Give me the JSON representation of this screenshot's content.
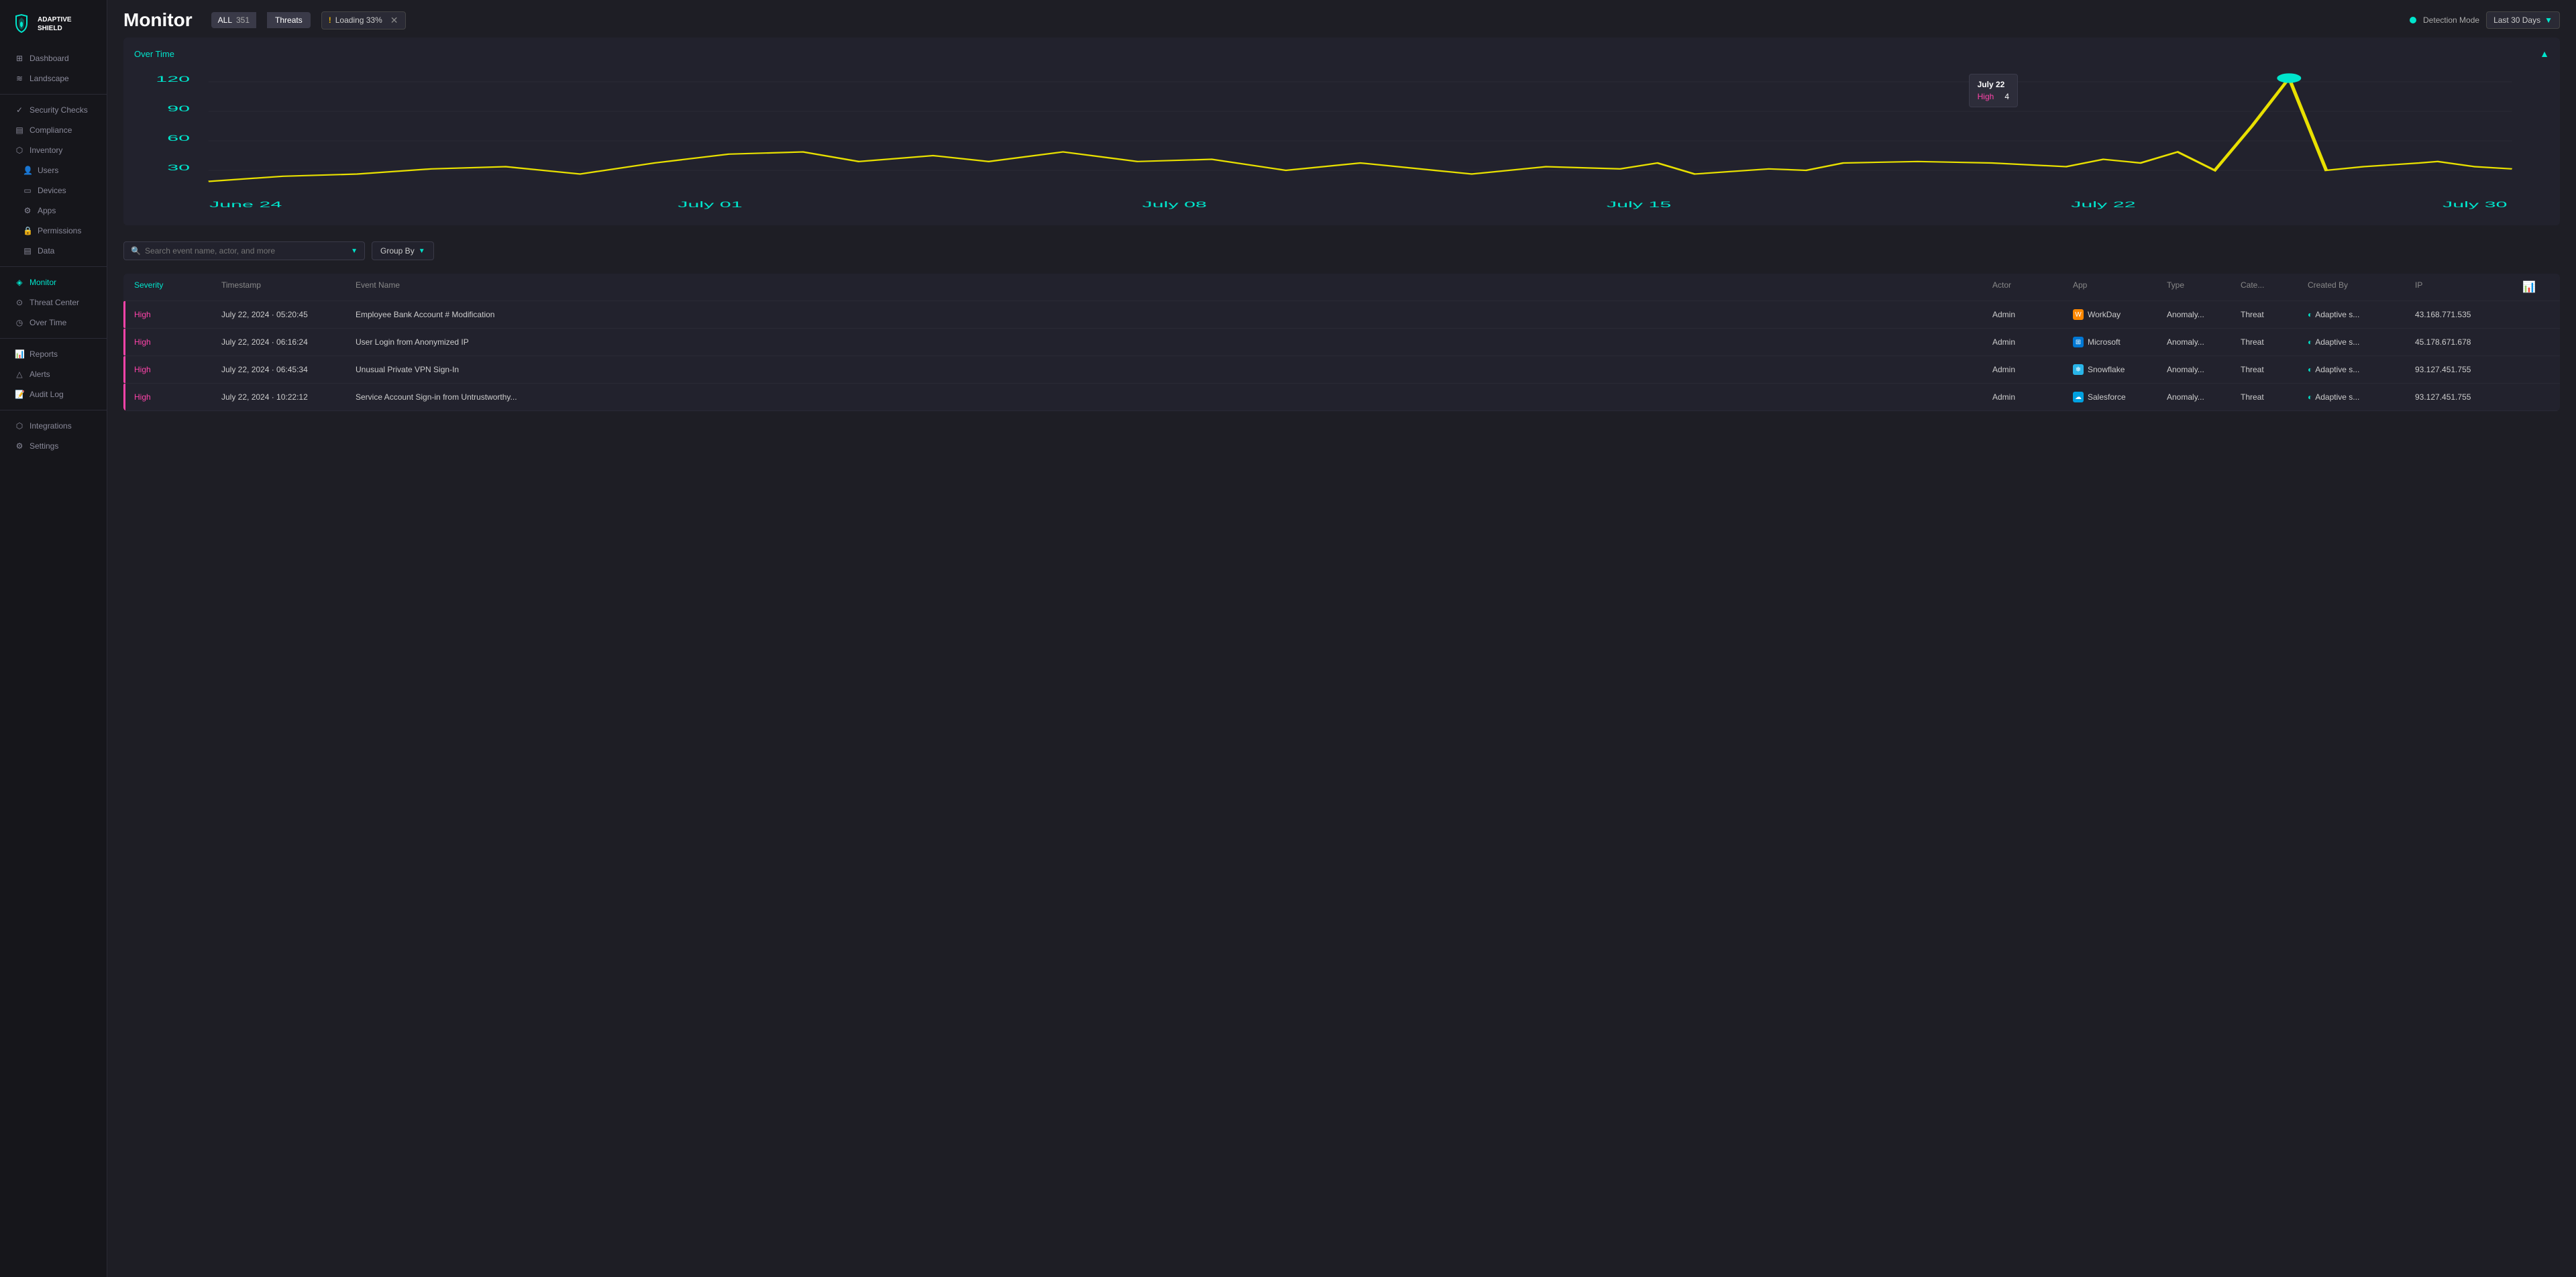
{
  "app": {
    "name": "Adaptive Shield",
    "logo_text": "ADAPTIVE\nSHIELD"
  },
  "sidebar": {
    "items": [
      {
        "id": "dashboard",
        "label": "Dashboard",
        "icon": "⊞",
        "active": false
      },
      {
        "id": "landscape",
        "label": "Landscape",
        "icon": "≋",
        "active": false
      },
      {
        "id": "security-checks",
        "label": "Security Checks",
        "icon": "✓",
        "active": false
      },
      {
        "id": "compliance",
        "label": "Compliance",
        "icon": "📋",
        "active": false
      },
      {
        "id": "inventory",
        "label": "Inventory",
        "icon": "🗂",
        "active": false
      },
      {
        "id": "users",
        "label": "Users",
        "icon": "👤",
        "active": false,
        "sub": true
      },
      {
        "id": "devices",
        "label": "Devices",
        "icon": "💻",
        "active": false,
        "sub": true
      },
      {
        "id": "apps",
        "label": "Apps",
        "icon": "⚙",
        "active": false,
        "sub": true
      },
      {
        "id": "permissions",
        "label": "Permissions",
        "icon": "🔒",
        "active": false,
        "sub": true
      },
      {
        "id": "data",
        "label": "Data",
        "icon": "🗄",
        "active": false,
        "sub": true
      },
      {
        "id": "monitor",
        "label": "Monitor",
        "icon": "◈",
        "active": true
      },
      {
        "id": "threat-center",
        "label": "Threat Center",
        "icon": "⊙",
        "active": false
      },
      {
        "id": "over-time",
        "label": "Over Time",
        "icon": "◷",
        "active": false
      },
      {
        "id": "reports",
        "label": "Reports",
        "icon": "📊",
        "active": false
      },
      {
        "id": "alerts",
        "label": "Alerts",
        "icon": "△",
        "active": false
      },
      {
        "id": "audit-log",
        "label": "Audit Log",
        "icon": "📝",
        "active": false
      },
      {
        "id": "integrations",
        "label": "Integrations",
        "icon": "⬡",
        "active": false
      },
      {
        "id": "settings",
        "label": "Settings",
        "icon": "⚙",
        "active": false
      }
    ]
  },
  "header": {
    "title": "Monitor",
    "tab_all": "ALL",
    "tab_count": "351",
    "tab_threats": "Threats",
    "loading_text": "Loading 33%",
    "detection_label": "Detection Mode",
    "days_label": "Last 30 Days"
  },
  "chart": {
    "title": "Over Time",
    "y_labels": [
      "120",
      "90",
      "60",
      "30"
    ],
    "x_labels": [
      "June 24",
      "July 01",
      "July 08",
      "July 15",
      "July 22",
      "July 30"
    ],
    "tooltip": {
      "date": "July 22",
      "label": "High",
      "value": "4"
    }
  },
  "filters": {
    "search_placeholder": "Search event name, actor, and more",
    "group_by_label": "Group By"
  },
  "table": {
    "columns": [
      "Severity",
      "Timestamp",
      "Event Name",
      "Actor",
      "App",
      "Type",
      "Cate...",
      "Created By",
      "IP"
    ],
    "rows": [
      {
        "severity": "High",
        "timestamp": "July 22, 2024 · 05:20:45",
        "event_name": "Employee Bank Account # Modification",
        "actor": "Admin",
        "app": "WorkDay",
        "app_icon": "W",
        "app_color": "#ff8800",
        "type": "Anomaly...",
        "category": "Threat",
        "created_by": "Adaptive s...",
        "ip": "43.168.771.535"
      },
      {
        "severity": "High",
        "timestamp": "July 22, 2024 · 06:16:24",
        "event_name": "User Login from Anonymized IP",
        "actor": "Admin",
        "app": "Microsoft",
        "app_icon": "M",
        "app_color": "#0078d4",
        "type": "Anomaly...",
        "category": "Threat",
        "created_by": "Adaptive s...",
        "ip": "45.178.671.678"
      },
      {
        "severity": "High",
        "timestamp": "July 22, 2024 · 06:45:34",
        "event_name": "Unusual Private VPN Sign-In",
        "actor": "Admin",
        "app": "Snowflake",
        "app_icon": "❄",
        "app_color": "#29b5e8",
        "type": "Anomaly...",
        "category": "Threat",
        "created_by": "Adaptive s...",
        "ip": "93.127.451.755"
      },
      {
        "severity": "High",
        "timestamp": "July 22, 2024 · 10:22:12",
        "event_name": "Service Account Sign-in from Untrustworthy...",
        "actor": "Admin",
        "app": "Salesforce",
        "app_icon": "☁",
        "app_color": "#00a1e0",
        "type": "Anomaly...",
        "category": "Threat",
        "created_by": "Adaptive s...",
        "ip": "93.127.451.755"
      }
    ]
  },
  "colors": {
    "accent": "#00e5cc",
    "high_severity": "#ff44aa",
    "chart_line": "#e8e000",
    "bg_main": "#1e1e25",
    "bg_sidebar": "#16161b",
    "bg_card": "#22222d"
  }
}
